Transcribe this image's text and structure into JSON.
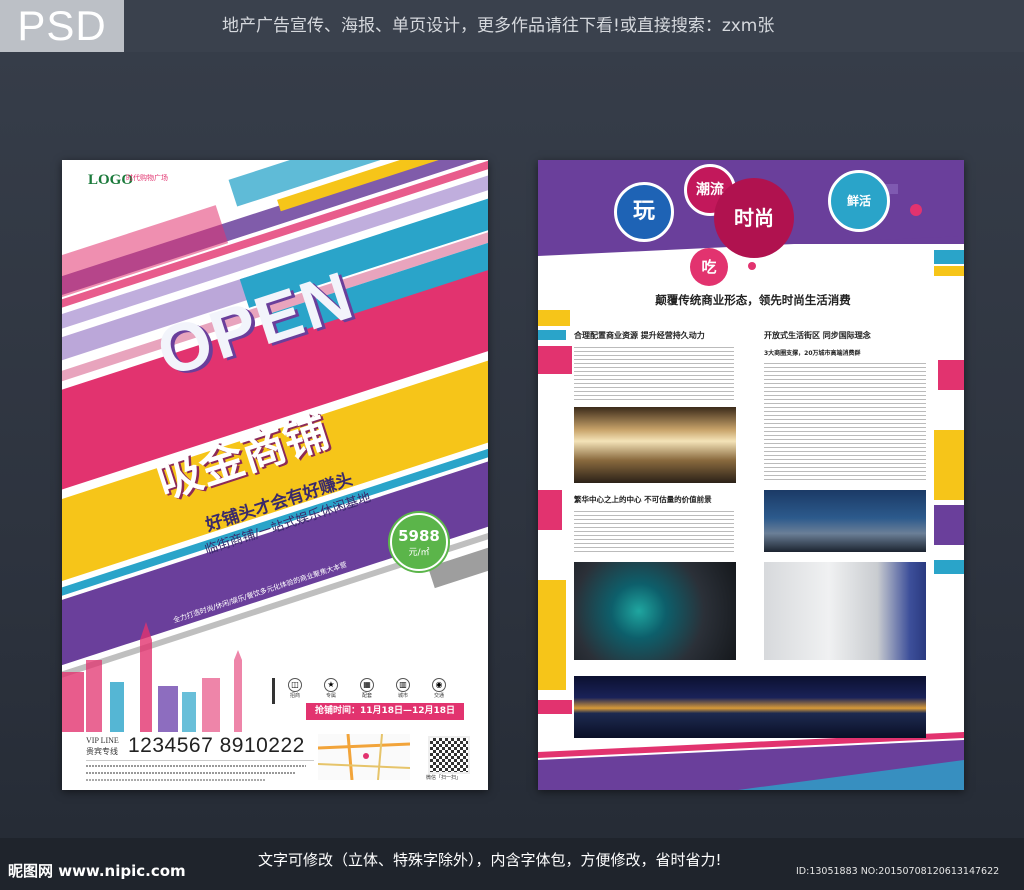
{
  "header": {
    "badge": "PSD",
    "tagline": "地产广告宣传、海报、单页设计，更多作品请往下看!或直接搜索：zxm张"
  },
  "footer": {
    "site": "昵图网 www.nipic.com",
    "note": "文字可修改（立体、特殊字除外），内含字体包，方便修改，省时省力!",
    "id_line": "ID:13051883 NO:20150708120613147622"
  },
  "poster_front": {
    "logo": "LOGO",
    "logo_sub": "时代购物广场",
    "headline": "OPEN",
    "title": "吸金商铺",
    "slogan": "好铺头才会有好赚头",
    "subslogan": "临街商铺/一站式娱乐休闲基地",
    "price": "5988",
    "price_unit": "元/㎡",
    "feature_line": "全力打造时尚/休闲/娱乐/餐饮多元化体验的商业聚焦大本营",
    "icons": [
      {
        "label": "招商",
        "icon": "shop-icon"
      },
      {
        "label": "专属",
        "icon": "star-icon"
      },
      {
        "label": "配套",
        "icon": "building-icon"
      },
      {
        "label": "城市",
        "icon": "city-icon"
      },
      {
        "label": "交通",
        "icon": "car-icon"
      }
    ],
    "date_banner": "抢铺时间：11月18日—12月18日",
    "vip_label": "VIP LINE",
    "vip_cn": "贵宾专线",
    "phone": "1234567 8910222",
    "qr_caption": "微信「扫一扫」"
  },
  "poster_back": {
    "bubbles": [
      "玩",
      "潮流",
      "时尚",
      "鲜活",
      "吃"
    ],
    "main_heading": "颠覆传统商业形态，领先时尚生活消费",
    "col1_heading": "合理配置商业资源  提升经营持久动力",
    "col2_heading": "开放式生活街区  同步国际理念",
    "col2_sub": "3大商圈支撑，20万城市高端消费群",
    "col1b_heading": "繁华中心之上的中心  不可估量的价值前景"
  },
  "colors": {
    "magenta": "#e2336f",
    "purple": "#6a3f9b",
    "yellow": "#f6c519",
    "teal": "#2aa4c9",
    "green": "#5bb54a"
  }
}
